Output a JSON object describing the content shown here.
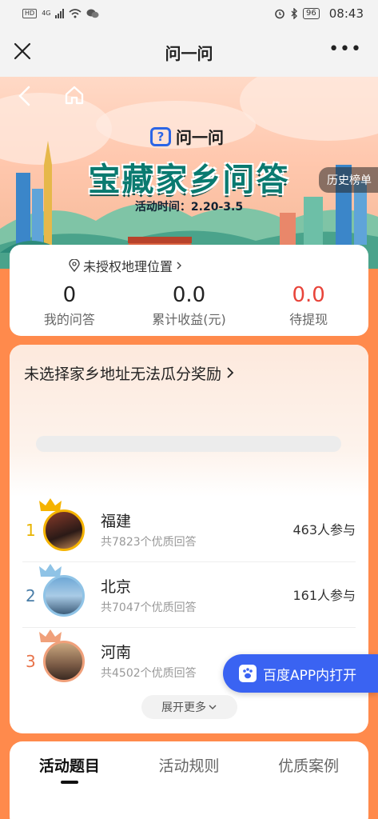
{
  "status_bar": {
    "left_tag": "HD",
    "network": "4G",
    "time": "08:43",
    "battery": "96"
  },
  "title_bar": {
    "title": "问一问",
    "more": "•••"
  },
  "hero": {
    "brand": "问一问",
    "brand_logo": "?",
    "title": "宝藏家乡问答",
    "activity_time": "活动时间：2.20-3.5",
    "history": "历史榜单"
  },
  "stats": {
    "location": "未授权地理位置",
    "items": [
      {
        "value": "0",
        "label": "我的问答"
      },
      {
        "value": "0.0",
        "label": "累计收益(元)"
      },
      {
        "value": "0.0",
        "label": "待提现"
      }
    ]
  },
  "ranking": {
    "heading": "未选择家乡地址无法瓜分奖励",
    "items": [
      {
        "rank": "1",
        "name": "福建",
        "sub": "共7823个优质回答",
        "count": "463人参与",
        "rank_color": "#e8b400"
      },
      {
        "rank": "2",
        "name": "北京",
        "sub": "共7047个优质回答",
        "count": "161人参与",
        "rank_color": "#4a7ea8"
      },
      {
        "rank": "3",
        "name": "河南",
        "sub": "共4502个优质回答",
        "count": "",
        "rank_color": "#e8734a"
      }
    ],
    "expand": "展开更多"
  },
  "open_app": "百度APP内打开",
  "tabs": [
    {
      "label": "活动题目",
      "active": true
    },
    {
      "label": "活动规则",
      "active": false
    },
    {
      "label": "优质案例",
      "active": false
    }
  ],
  "colors": {
    "accent_orange": "#ff8a4c",
    "brand_blue": "#3a63f2",
    "title_teal": "#0a7a70",
    "money_red": "#e8443a"
  }
}
